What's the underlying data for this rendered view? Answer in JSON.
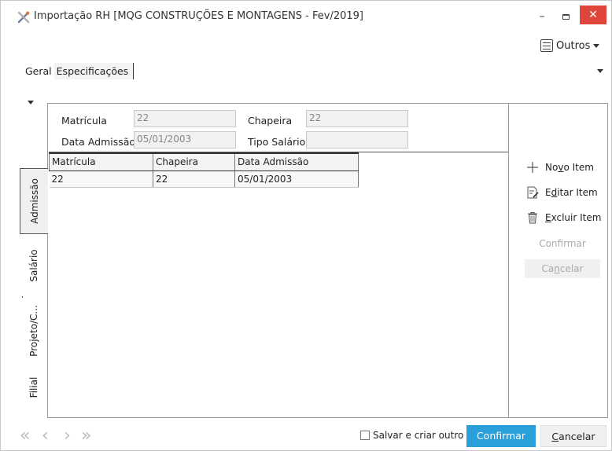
{
  "window": {
    "title": "Importação RH [MQG CONSTRUÇÕES E MONTAGENS - Fev/2019]",
    "controls": {
      "minimize": "–",
      "close": "✕"
    }
  },
  "toolbar": {
    "outros_label": "Outros"
  },
  "tabs": [
    {
      "label": "Geral",
      "active": false
    },
    {
      "label": "Especificações",
      "active": true
    }
  ],
  "vertical_tabs": [
    {
      "label": "Admissão",
      "active": true
    },
    {
      "label": "Salário",
      "active": false
    },
    {
      "label": "Projeto/C...",
      "active": false
    },
    {
      "label": "Filial",
      "active": false
    }
  ],
  "form": {
    "matricula": {
      "label": "Matrícula",
      "value": "22"
    },
    "chapeira": {
      "label": "Chapeira",
      "value": "22"
    },
    "data_admissao": {
      "label": "Data Admissão",
      "value": "05/01/2003"
    },
    "tipo_salario": {
      "label": "Tipo Salário",
      "value": ""
    }
  },
  "grid": {
    "columns": [
      "Matrícula",
      "Chapeira",
      "Data Admissão"
    ],
    "rows": [
      [
        "22",
        "22",
        "05/01/2003"
      ]
    ]
  },
  "side_actions": {
    "novo_item": {
      "pre": "No",
      "u": "v",
      "post": "o Item"
    },
    "editar_item": {
      "pre": "E",
      "u": "d",
      "post": "itar Item"
    },
    "excluir_item": {
      "pre": "",
      "u": "E",
      "post": "xcluir Item"
    },
    "confirmar": "Confirmar",
    "cancelar": {
      "pre": "Ca",
      "u": "n",
      "post": "celar"
    }
  },
  "footer": {
    "nav": {
      "first": "«",
      "prev": "‹",
      "next": "›",
      "last": "»"
    },
    "save_and_create": "Salvar e criar outro",
    "confirm": "Confirmar",
    "cancel": {
      "pre": "",
      "u": "C",
      "post": "ancelar"
    }
  },
  "colors": {
    "accent": "#2b9fd9",
    "close": "#e0453b",
    "disabled_text": "#aaaaaa"
  }
}
